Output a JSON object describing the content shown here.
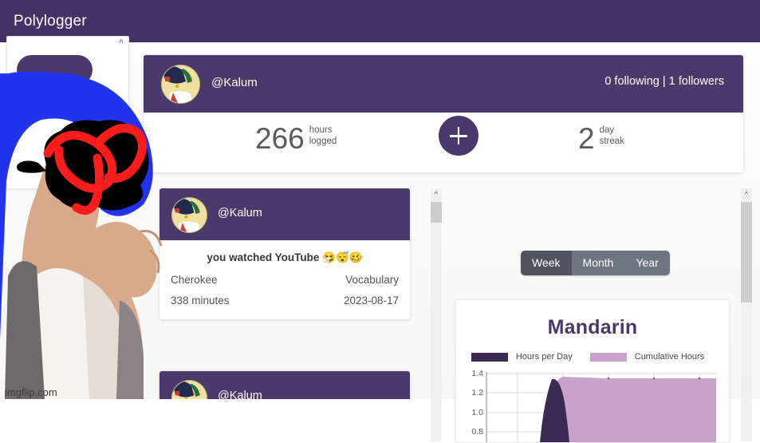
{
  "window": {
    "app_title": "Polylogger"
  },
  "profile": {
    "handle": "@Kalum",
    "follow_stats": "0 following | 1 followers",
    "hours": {
      "value": "266",
      "unit_line1": "hours",
      "unit_line2": "logged"
    },
    "streak": {
      "value": "2",
      "unit_line1": "day",
      "unit_line2": "streak"
    },
    "add_button": "+"
  },
  "feed": {
    "cards": [
      {
        "handle": "@Kalum",
        "title": "you watched YouTube 🤧😴🥴",
        "language": "Cherokee",
        "category": "Vocabulary",
        "duration": "338 minutes",
        "date": "2023-08-17"
      },
      {
        "handle": "@Kalum"
      }
    ]
  },
  "range_toggle": {
    "options": [
      "Week",
      "Month",
      "Year"
    ],
    "selected": "Week"
  },
  "chart_data": {
    "type": "area",
    "title": "Mandarin",
    "xlabel": "",
    "ylabel": "",
    "ylim": [
      0.6,
      1.45
    ],
    "yticks": [
      1.4,
      1.2,
      1.0,
      0.8
    ],
    "ytick_labels": [
      "1.4",
      "1.2",
      "1.0",
      "0.8"
    ],
    "grid": true,
    "legend_position": "top-center",
    "x": [
      0,
      1,
      2,
      3,
      4,
      5,
      6
    ],
    "series": [
      {
        "name": "Hours per Day",
        "color": "#3d2a52",
        "values": [
          0,
          0,
          1.35,
          0,
          0,
          0,
          0
        ]
      },
      {
        "name": "Cumulative Hours",
        "color": "#c9a2cc",
        "values": [
          0,
          0,
          1.36,
          1.35,
          1.35,
          1.35,
          1.35
        ]
      }
    ]
  },
  "watermark": {
    "text": "imgflip.com"
  },
  "colors": {
    "brand_purple": "#433266",
    "card_purple": "#4a3a6b",
    "series_dark": "#3d2a52",
    "series_light": "#c9a2cc",
    "toggle_active": "#4e555e",
    "toggle_inactive": "#6d7580"
  }
}
